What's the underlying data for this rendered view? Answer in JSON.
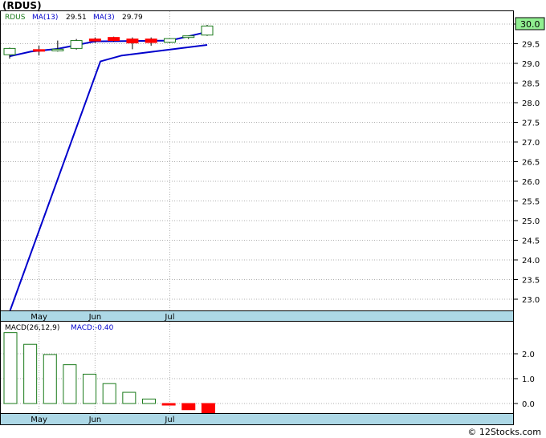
{
  "title": "(RDUS)",
  "credit": "© 12Stocks.com",
  "price_legend": {
    "symbol": "RDUS",
    "ma13_label": "MA(13)",
    "ma13_value": "29.51",
    "ma3_label": "MA(3)",
    "ma3_value": "29.79"
  },
  "macd_legend": {
    "label": "MACD(26,12,9)",
    "value_label": "MACD:-0.40"
  },
  "colors": {
    "up": "#1a7a1a",
    "down": "#ff0000",
    "ma_line": "#0000cc",
    "axis_band": "#add8e6",
    "current_price_bg": "#90ee90",
    "grid": "#b0b0b0",
    "legend_symbol": "#1a7a1a",
    "legend_ma": "#0000cc"
  },
  "chart_data": [
    {
      "type": "candlestick",
      "title": "(RDUS)",
      "x_tick_labels": [
        "May",
        "Jun",
        "Jul"
      ],
      "y_ticks": [
        23.0,
        23.5,
        24.0,
        24.5,
        25.0,
        25.5,
        26.0,
        26.5,
        27.0,
        27.5,
        28.0,
        28.5,
        29.0,
        29.5,
        30.0
      ],
      "y_tick_labels": [
        "23.0",
        "23.5",
        "24.0",
        "24.5",
        "25.0",
        "25.5",
        "26.0",
        "26.5",
        "27.0",
        "27.5",
        "28.0",
        "28.5",
        "29.0",
        "29.5",
        "30.0"
      ],
      "ylim": [
        22.6,
        30.15
      ],
      "current_price": "30.0",
      "x_days": [
        0,
        11,
        18,
        25,
        32,
        39,
        46,
        53,
        60,
        67,
        74
      ],
      "x_tick_days": [
        11,
        32,
        60
      ],
      "x_range": [
        -1,
        80
      ],
      "candles": [
        {
          "o": 29.22,
          "h": 29.4,
          "l": 29.12,
          "c": 29.38
        },
        {
          "o": 29.35,
          "h": 29.45,
          "l": 29.2,
          "c": 29.33
        },
        {
          "o": 29.34,
          "h": 29.58,
          "l": 29.3,
          "c": 29.36
        },
        {
          "o": 29.38,
          "h": 29.62,
          "l": 29.35,
          "c": 29.58
        },
        {
          "o": 29.62,
          "h": 29.66,
          "l": 29.52,
          "c": 29.57
        },
        {
          "o": 29.66,
          "h": 29.68,
          "l": 29.55,
          "c": 29.58
        },
        {
          "o": 29.62,
          "h": 29.66,
          "l": 29.36,
          "c": 29.52
        },
        {
          "o": 29.62,
          "h": 29.66,
          "l": 29.45,
          "c": 29.53
        },
        {
          "o": 29.54,
          "h": 29.64,
          "l": 29.52,
          "c": 29.63
        },
        {
          "o": 29.66,
          "h": 29.7,
          "l": 29.62,
          "c": 29.7
        },
        {
          "o": 29.72,
          "h": 29.98,
          "l": 29.7,
          "c": 29.95
        }
      ],
      "series": [
        {
          "name": "MA(13)",
          "x": [
            0,
            34,
            42,
            74
          ],
          "values": [
            22.68,
            29.05,
            29.2,
            29.47
          ]
        },
        {
          "name": "MA(3)",
          "x": [
            0,
            8,
            18,
            32,
            46,
            60,
            74
          ],
          "values": [
            29.18,
            29.3,
            29.37,
            29.56,
            29.57,
            29.58,
            29.8
          ]
        }
      ]
    },
    {
      "type": "bar",
      "title": "MACD(26,12,9)",
      "x_tick_labels": [
        "May",
        "Jun",
        "Jul"
      ],
      "y_ticks": [
        0.0,
        1.0,
        2.0
      ],
      "y_tick_labels": [
        "0.0",
        "1.0",
        "2.0"
      ],
      "ylim": [
        -0.45,
        2.95
      ],
      "x_days": [
        0,
        7,
        14,
        21,
        28,
        35,
        42,
        49,
        56,
        63,
        70
      ],
      "values": [
        2.85,
        2.38,
        1.97,
        1.56,
        1.18,
        0.8,
        0.45,
        0.18,
        -0.06,
        -0.25,
        -0.4
      ]
    }
  ]
}
